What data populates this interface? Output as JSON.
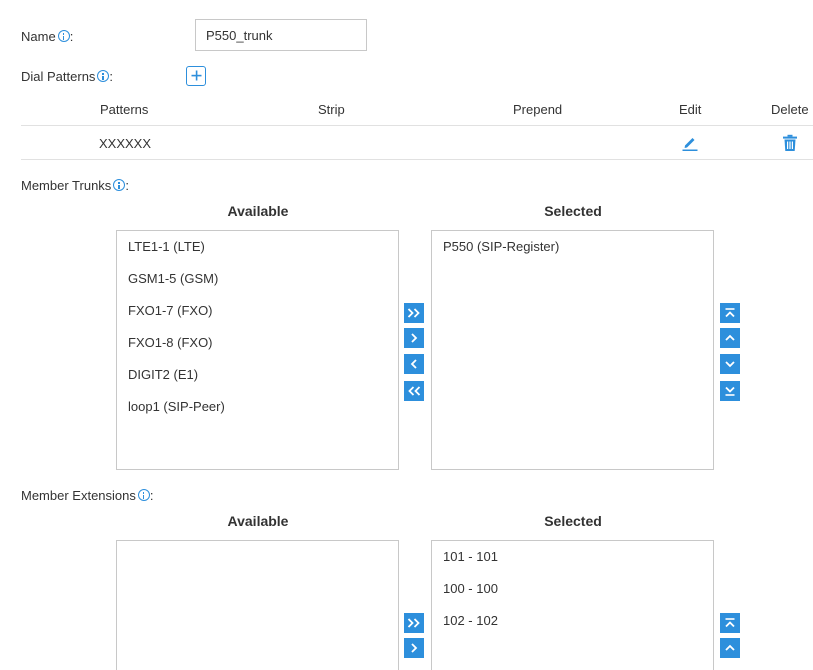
{
  "name": {
    "label": "Name",
    "colon": ":",
    "value": "P550_trunk"
  },
  "dial_patterns": {
    "label": "Dial Patterns",
    "colon": ":",
    "columns": [
      "Patterns",
      "Strip",
      "Prepend",
      "Edit",
      "Delete"
    ],
    "rows": [
      {
        "pattern": "XXXXXX",
        "strip": "",
        "prepend": ""
      }
    ]
  },
  "member_trunks": {
    "label": "Member Trunks",
    "colon": ":",
    "available_title": "Available",
    "selected_title": "Selected",
    "available": [
      "LTE1-1 (LTE)",
      "GSM1-5 (GSM)",
      "FXO1-7 (FXO)",
      "FXO1-8 (FXO)",
      "DIGIT2 (E1)",
      "loop1 (SIP-Peer)"
    ],
    "selected": [
      "P550 (SIP-Register)"
    ]
  },
  "member_extensions": {
    "label": "Member Extensions",
    "colon": ":",
    "available_title": "Available",
    "selected_title": "Selected",
    "available": [],
    "selected": [
      "101 - 101",
      "100 - 100",
      "102 - 102"
    ]
  },
  "colors": {
    "accent": "#2d8fdc",
    "border": "#c8c8c8",
    "text": "#333333"
  }
}
